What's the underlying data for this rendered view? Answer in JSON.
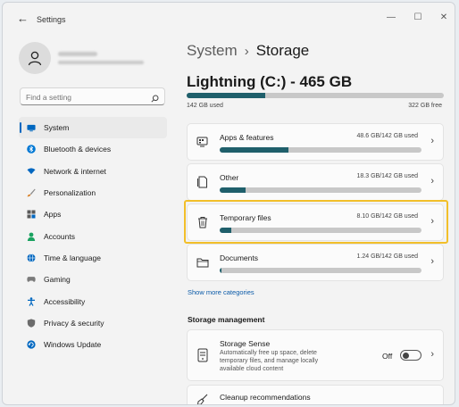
{
  "app": {
    "title": "Settings",
    "back_glyph": "←"
  },
  "window_controls": {
    "minimize": "—",
    "maximize": "☐",
    "close": "✕"
  },
  "search": {
    "placeholder": "Find a setting"
  },
  "sidebar": {
    "items": [
      {
        "label": "System",
        "icon": "monitor-icon",
        "color": "#0067c0",
        "active": true
      },
      {
        "label": "Bluetooth & devices",
        "icon": "bluetooth-icon",
        "color": "#0078d4"
      },
      {
        "label": "Network & internet",
        "icon": "wifi-icon",
        "color": "#0067c0"
      },
      {
        "label": "Personalization",
        "icon": "brush-icon",
        "color": "#d9822b"
      },
      {
        "label": "Apps",
        "icon": "apps-icon",
        "color": "#5a5a5a"
      },
      {
        "label": "Accounts",
        "icon": "person-icon",
        "color": "#1aa260"
      },
      {
        "label": "Time & language",
        "icon": "globe-icon",
        "color": "#0067c0"
      },
      {
        "label": "Gaming",
        "icon": "gamepad-icon",
        "color": "#7a7a7a"
      },
      {
        "label": "Accessibility",
        "icon": "accessibility-icon",
        "color": "#0067c0"
      },
      {
        "label": "Privacy & security",
        "icon": "shield-icon",
        "color": "#6b6b6b"
      },
      {
        "label": "Windows Update",
        "icon": "update-icon",
        "color": "#0067c0"
      }
    ]
  },
  "breadcrumb": {
    "parent": "System",
    "separator": "›",
    "current": "Storage"
  },
  "drive": {
    "title": "Lightning (C:) - 465 GB",
    "used": "142 GB used",
    "free": "322 GB free",
    "used_fraction": 0.305
  },
  "categories": [
    {
      "label": "Apps & features",
      "usage": "48.6 GB/142 GB used",
      "fraction": 0.342,
      "icon": "apps-features-icon"
    },
    {
      "label": "Other",
      "usage": "18.3 GB/142 GB used",
      "fraction": 0.129,
      "icon": "other-files-icon"
    },
    {
      "label": "Temporary files",
      "usage": "8.10 GB/142 GB used",
      "fraction": 0.057,
      "icon": "trash-icon"
    },
    {
      "label": "Documents",
      "usage": "1.24 GB/142 GB used",
      "fraction": 0.009,
      "icon": "folder-icon"
    }
  ],
  "show_more": "Show more categories",
  "management": {
    "title": "Storage management",
    "storage_sense": {
      "title": "Storage Sense",
      "description": "Automatically free up space, delete temporary files, and manage locally available cloud content",
      "state": "Off"
    },
    "cleanup": {
      "title": "Cleanup recommendations"
    }
  },
  "colors": {
    "accent": "#0067c0",
    "bar_fill": "#1f5f6b",
    "highlight": "#f2bf2a"
  }
}
